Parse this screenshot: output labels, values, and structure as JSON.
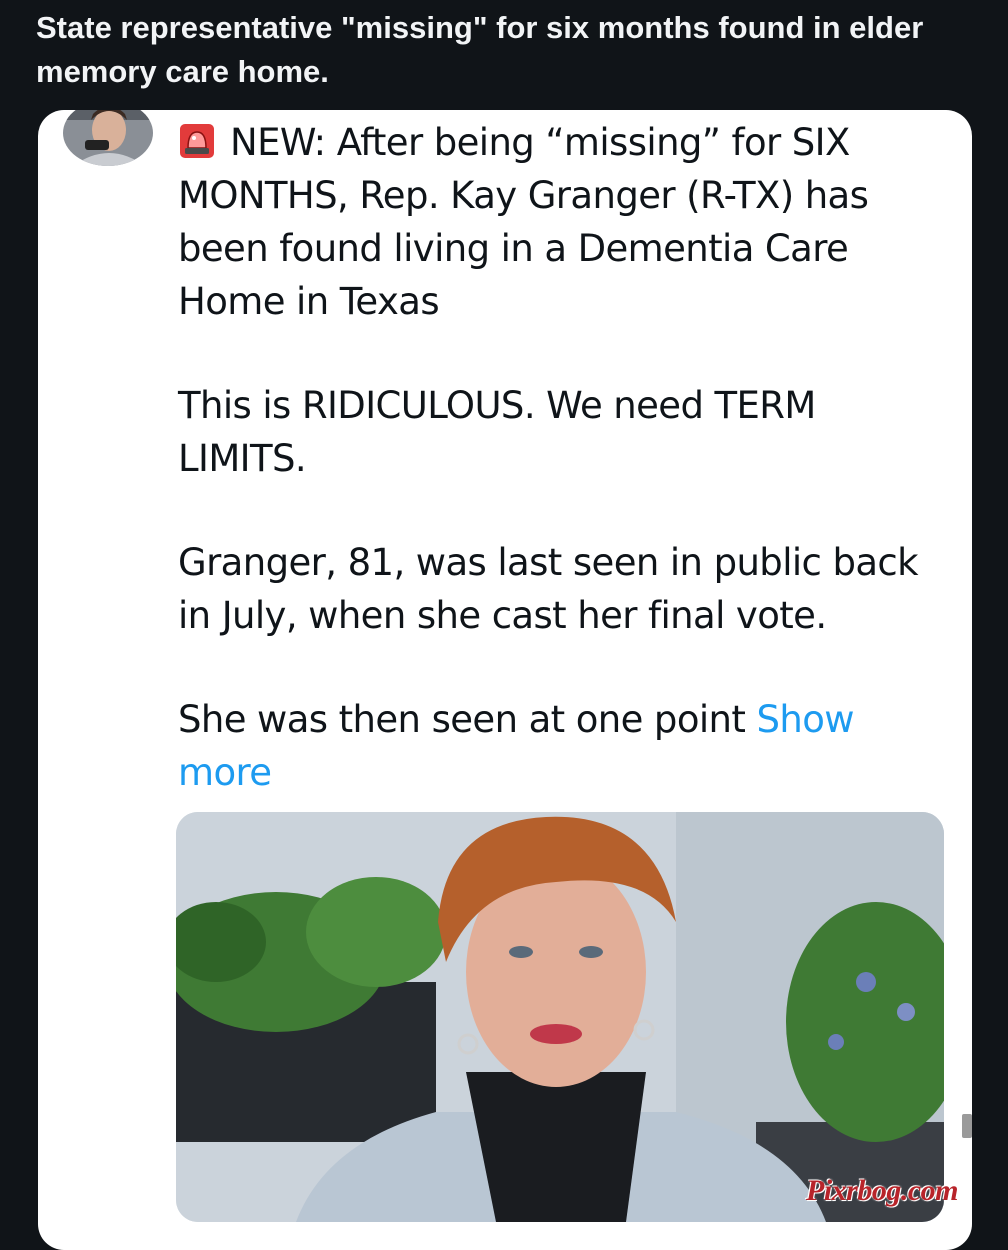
{
  "post": {
    "title": "State representative \"missing\" for six months found in elder memory care home."
  },
  "tweet": {
    "avatar_icon": "user-avatar-icon",
    "alert_icon": "police-car-light-icon",
    "paragraphs": [
      "NEW: After being “missing” for SIX MONTHS, Rep. Kay Granger (R-TX) has been found living in a Dementia Care Home in Texas",
      "This is RIDICULOUS. We need TERM LIMITS.",
      "Granger, 81, was last seen in public back in July, when she cast her final vote.",
      "She was then seen at one point"
    ],
    "show_more_label": "Show more",
    "link_color": "#1d9bf0"
  },
  "watermark": "Pixrbog.com"
}
